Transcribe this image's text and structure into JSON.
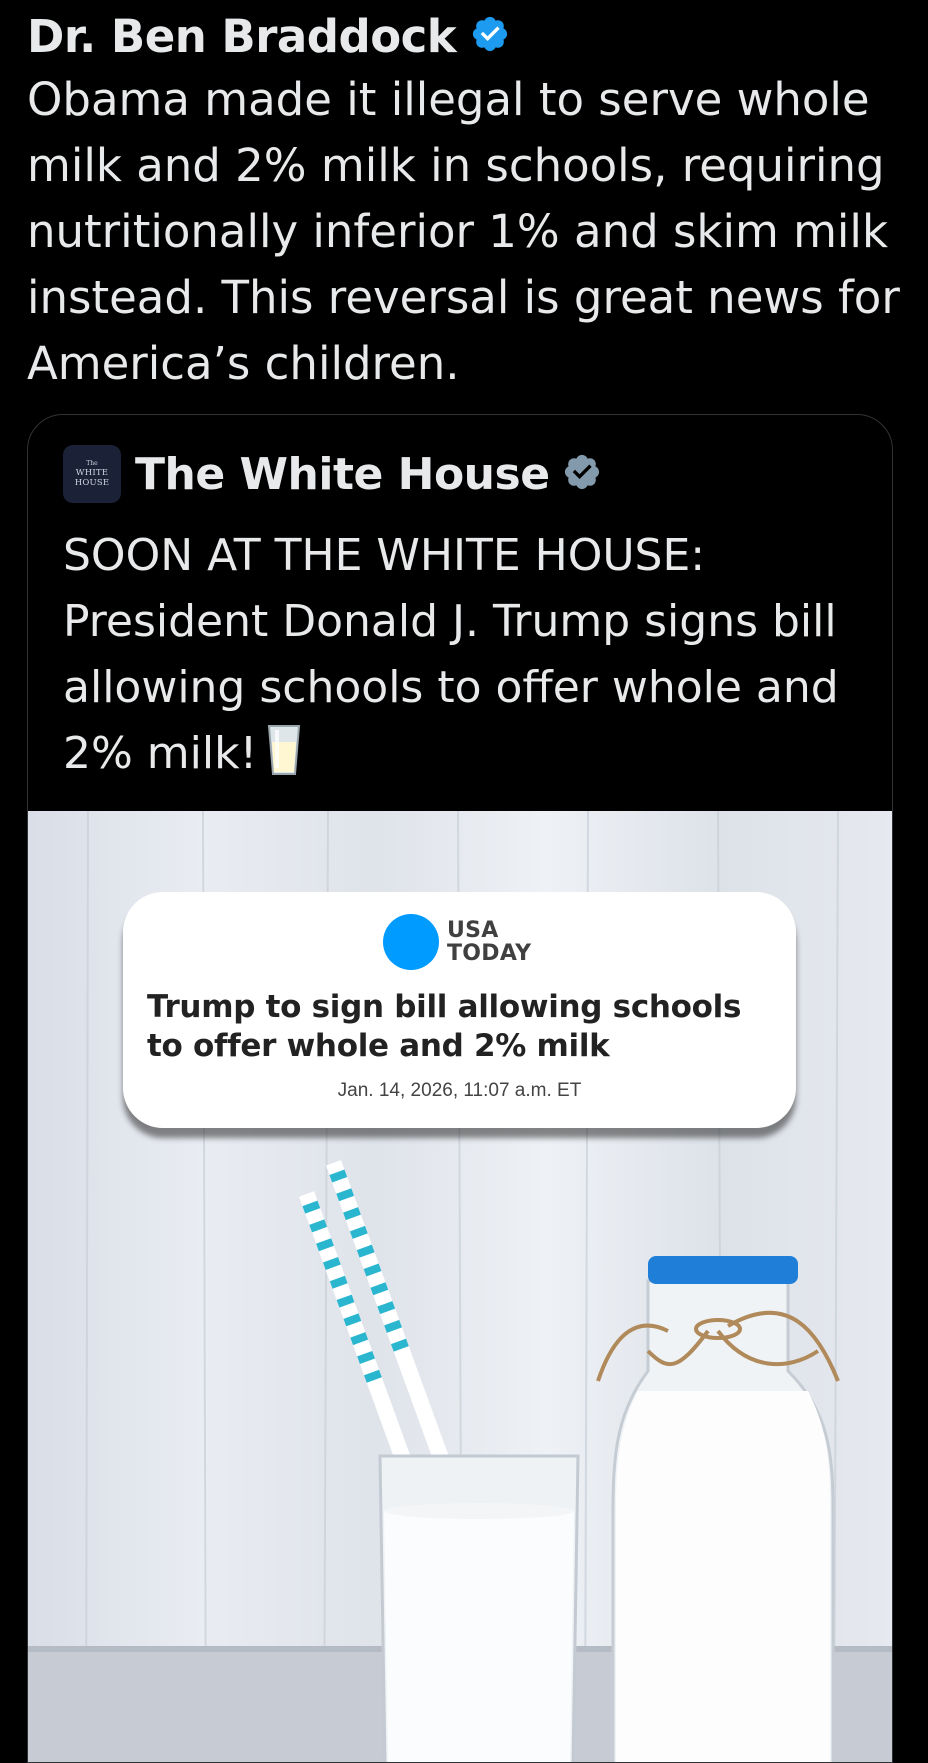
{
  "post": {
    "author_name": "Dr. Ben Braddock",
    "text": "Obama made it illegal to serve whole milk and 2% milk in schools, requiring nutritionally inferior 1% and skim milk instead. This reversal is great news for America’s children."
  },
  "quote": {
    "avatar_lines": [
      "The",
      "WHITE",
      "HOUSE"
    ],
    "author_name": "The White House",
    "text": "SOON AT THE WHITE HOUSE: President Donald J. Trump signs bill allowing schools to offer whole and 2% milk!",
    "emoji": "milk-glass-icon",
    "media": {
      "logo_line1": "USA",
      "logo_line2": "TODAY",
      "headline": "Trump to sign bill allowing schools to offer whole and 2% milk",
      "date": "Jan. 14, 2026, 11:07 a.m. ET"
    }
  },
  "colors": {
    "background": "#000000",
    "text": "#e7e9ea",
    "verified_blue": "#1d9bf0",
    "gov_badge_gray": "#829aab",
    "usa_today_blue": "#009bff",
    "straw_cyan": "#2bb6cf",
    "bottle_cap_blue": "#1f7fd8"
  }
}
